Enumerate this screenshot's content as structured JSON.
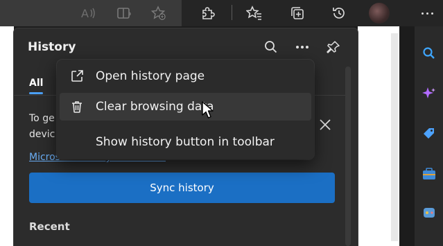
{
  "toolbar": {
    "icons": [
      "read-aloud-icon",
      "immersive-reader-icon",
      "add-favorite-icon",
      "extensions-icon",
      "favorites-icon",
      "collections-icon",
      "history-icon",
      "profile-avatar",
      "more-icon"
    ]
  },
  "panel": {
    "title": "History",
    "tab_all": "All",
    "info_line1": "To ge",
    "info_line2": "devic",
    "privacy_link": "Microsoft Privacy Statement",
    "sync_button": "Sync history",
    "recent_heading": "Recent"
  },
  "menu": {
    "items": [
      {
        "label": "Open history page",
        "icon": "open-external-icon"
      },
      {
        "label": "Clear browsing data",
        "icon": "trash-icon"
      },
      {
        "label": "Show history button in toolbar",
        "icon": ""
      }
    ]
  },
  "sidebar": {
    "icons": [
      "search-icon",
      "copilot-icon",
      "shopping-tag-icon",
      "tools-briefcase-icon",
      "games-icon"
    ]
  },
  "colors": {
    "accent": "#1b6fc4",
    "link": "#6aaef5",
    "panel_bg": "#2c2c2c",
    "menu_bg": "#2b2b2b"
  }
}
